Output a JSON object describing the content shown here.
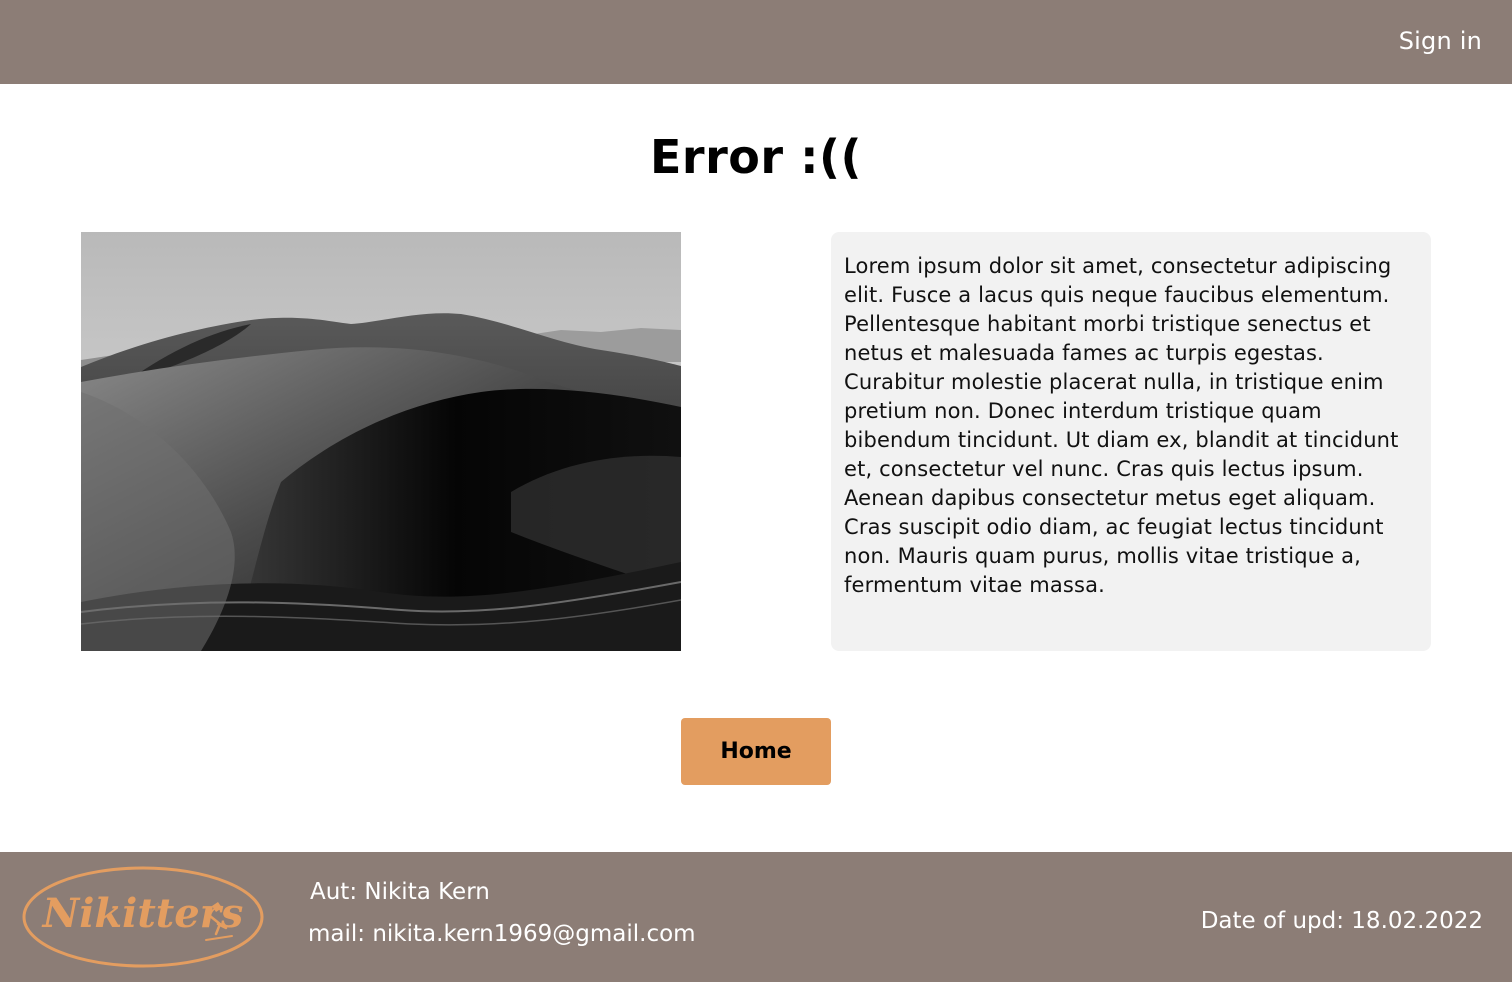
{
  "header": {
    "signin_label": "Sign in"
  },
  "main": {
    "title": "Error :((",
    "image_alt": "Black and white desert sand dunes",
    "description": "Lorem ipsum dolor sit amet, consectetur adipiscing elit. Fusce a lacus quis neque faucibus elementum. Pellentesque habitant morbi tristique senectus et netus et malesuada fames ac turpis egestas. Curabitur molestie placerat nulla, in tristique enim pretium non. Donec interdum tristique quam bibendum tincidunt. Ut diam ex, blandit at tincidunt et, consectetur vel nunc. Cras quis lectus ipsum. Aenean dapibus consectetur metus eget aliquam. Cras suscipit odio diam, ac feugiat lectus tincidunt non. Mauris quam purus, mollis vitae tristique a, fermentum vitae massa.",
    "home_button_label": "Home"
  },
  "footer": {
    "logo_text": "Nikitters",
    "author": "Aut: Nikita Kern",
    "mail": "mail: nikita.kern1969@gmail.com",
    "date": "Date of upd: 18.02.2022"
  },
  "colors": {
    "header_footer_bg": "#8c7d76",
    "accent": "#e39d60",
    "card_bg": "#f2f2f2"
  }
}
